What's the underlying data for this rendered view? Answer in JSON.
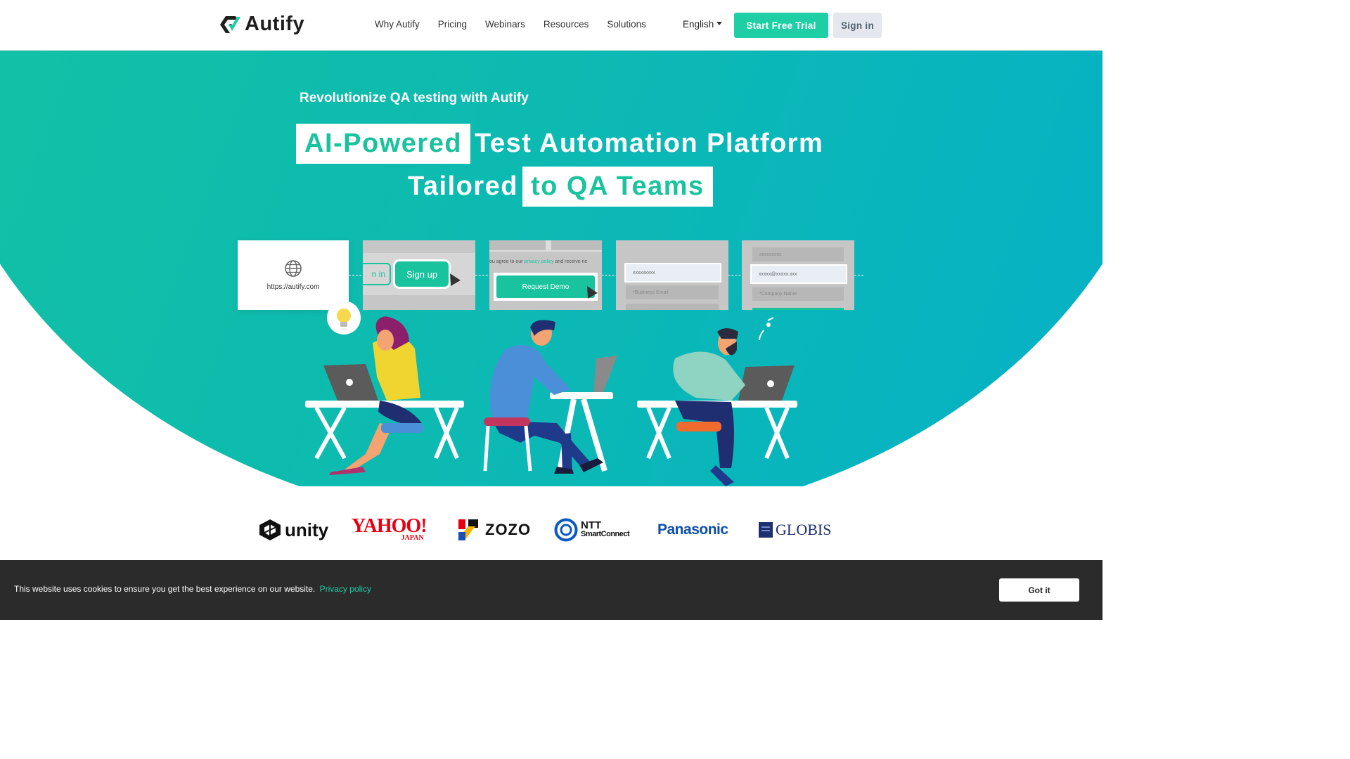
{
  "header": {
    "logo_text": "Autify",
    "nav": [
      "Why Autify",
      "Pricing",
      "Webinars",
      "Resources",
      "Solutions"
    ],
    "language": "English",
    "trial_button": "Start Free Trial",
    "signin_button": "Sign in"
  },
  "hero": {
    "tagline": "Revolutionize QA testing with Autify",
    "headline_line1_box": "AI-Powered",
    "headline_line1_rest": "Test Automation Platform",
    "headline_line2_plain": "Tailored",
    "headline_line2_box": "to QA Teams"
  },
  "steps": {
    "url": "https://autify.com",
    "signin_fragment": "n in",
    "signup": "Sign up",
    "privacy_pre": "ou agree to our",
    "privacy_link": "privacy policy",
    "privacy_post": "and receive ne",
    "request_demo": "Request Demo",
    "field1": "xxxxxxxxx",
    "field1_next": "*Business Email",
    "field2_prev": "xxxxxxxxx",
    "field2": "xxxxx@xxxxx.xxx",
    "field2_next": "*Company Name"
  },
  "logos": [
    "unity",
    "YAHOO!",
    "JAPAN",
    "ZOZO",
    "NTT",
    "SmartConnect",
    "Panasonic",
    "GLOBIS"
  ],
  "cookie": {
    "text": "This website uses cookies to ensure you get the best experience on our website.",
    "link": "Privacy policy",
    "button": "Got it"
  },
  "colors": {
    "brand_green": "#1ecfa6",
    "hero_gradient_start": "#15c3a2",
    "hero_gradient_end": "#05b0c8",
    "cookie_bg": "#2b2b2b"
  }
}
